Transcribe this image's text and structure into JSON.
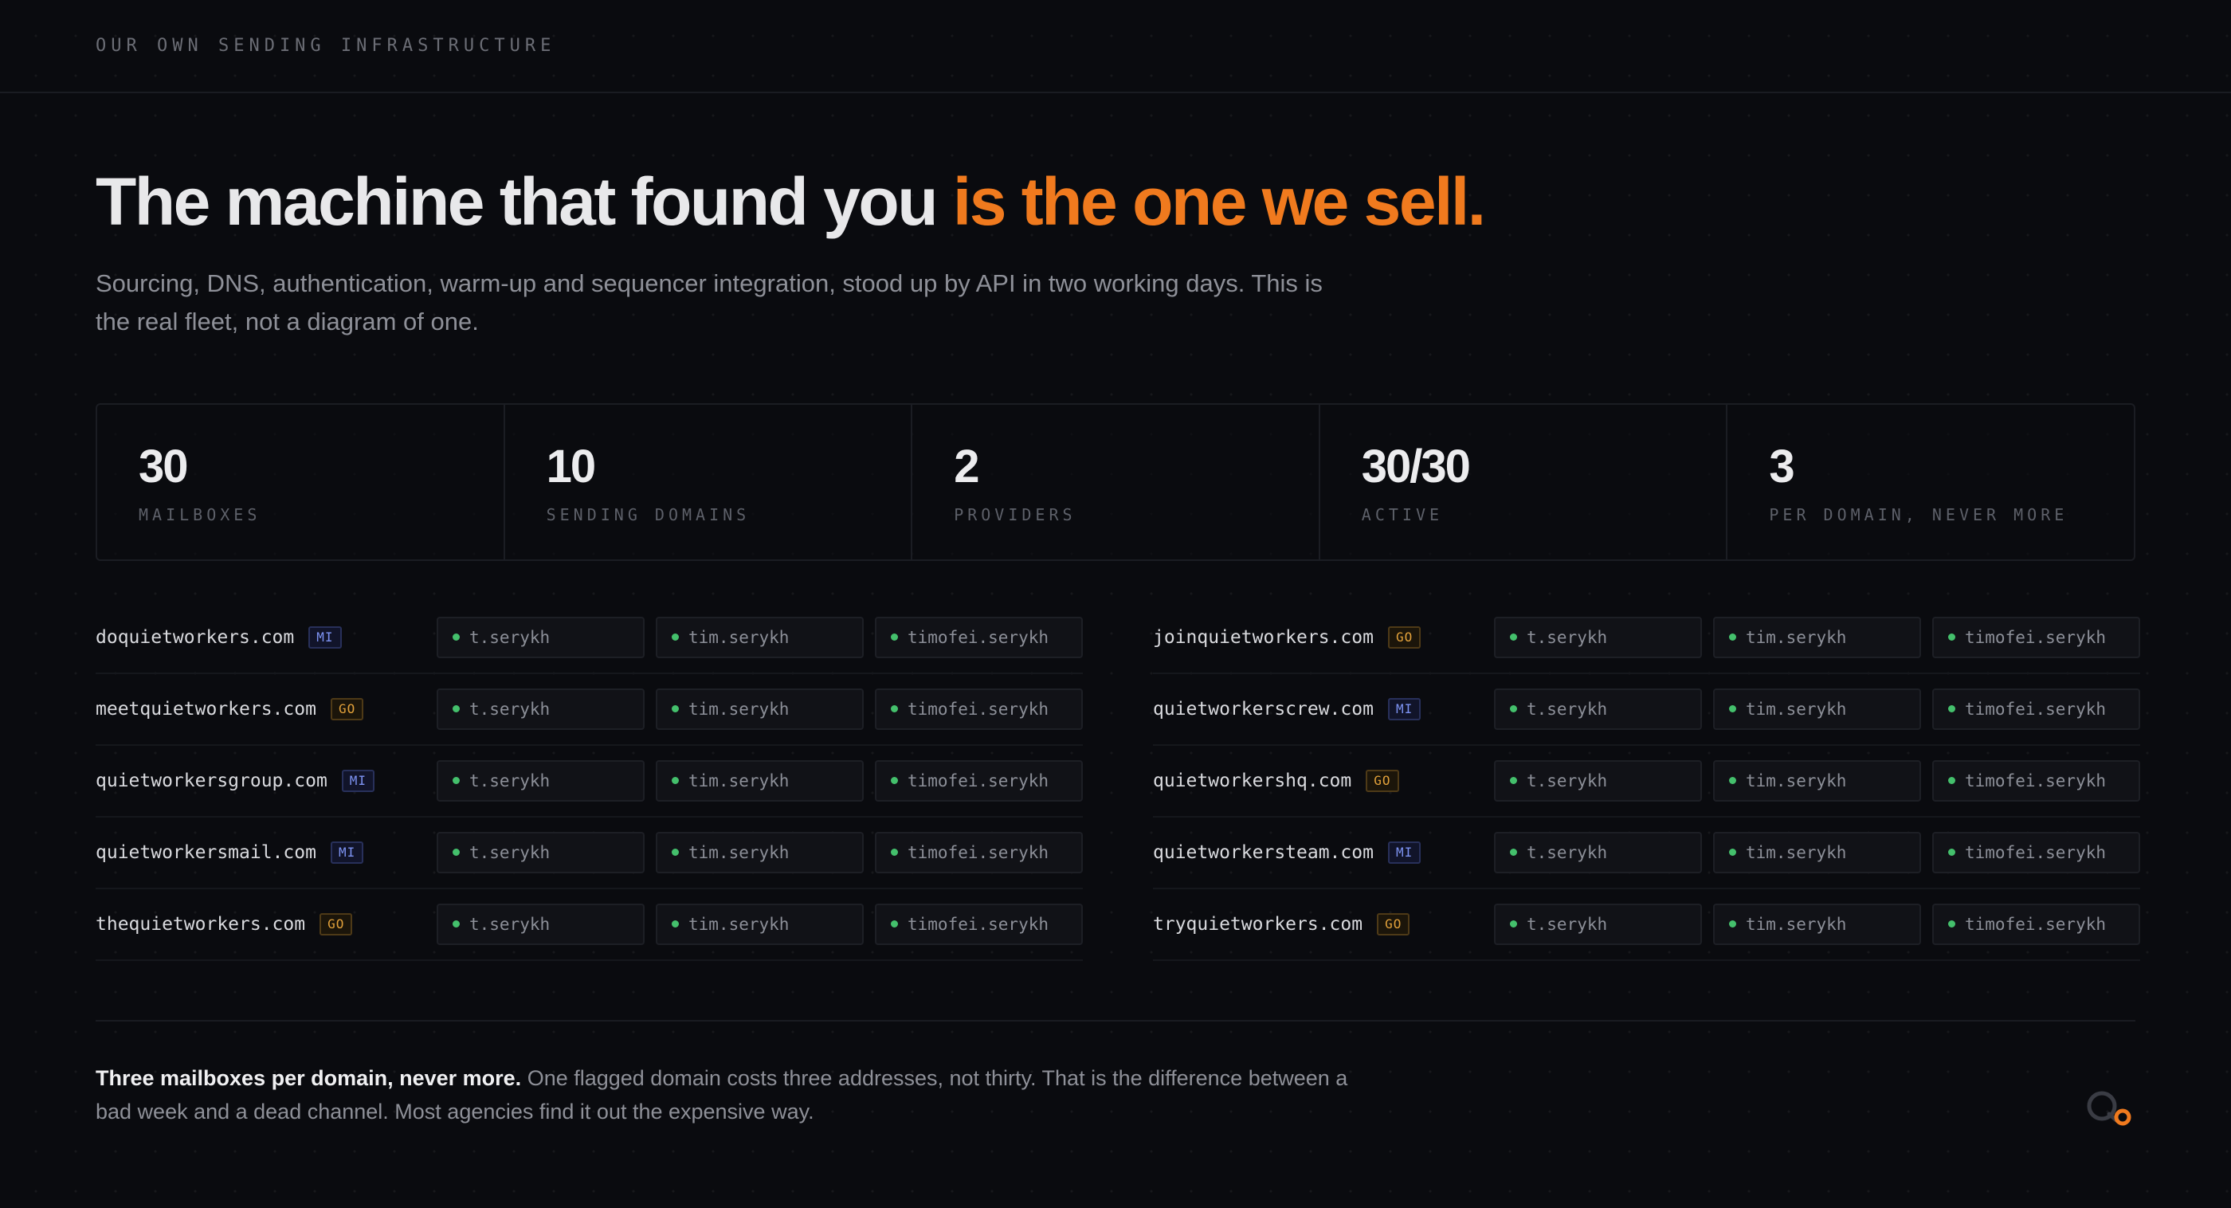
{
  "header": {
    "eyebrow": "OUR OWN SENDING INFRASTRUCTURE"
  },
  "hero": {
    "title_plain": "The machine that found you",
    "title_accent": "is the one we sell.",
    "subtitle": "Sourcing, DNS, authentication, warm-up and sequencer integration, stood up by API in two working days. This is the real fleet, not a diagram of one."
  },
  "stats": [
    {
      "value": "30",
      "label": "MAILBOXES"
    },
    {
      "value": "10",
      "label": "SENDING DOMAINS"
    },
    {
      "value": "2",
      "label": "PROVIDERS"
    },
    {
      "value": "30/30",
      "label": "ACTIVE"
    },
    {
      "value": "3",
      "label": "PER DOMAIN, NEVER MORE"
    }
  ],
  "mailbox_names": [
    "t.serykh",
    "tim.serykh",
    "timofei.serykh"
  ],
  "domains_left": [
    {
      "domain": "doquietworkers.com",
      "provider": "MI"
    },
    {
      "domain": "meetquietworkers.com",
      "provider": "GO"
    },
    {
      "domain": "quietworkersgroup.com",
      "provider": "MI"
    },
    {
      "domain": "quietworkersmail.com",
      "provider": "MI"
    },
    {
      "domain": "thequietworkers.com",
      "provider": "GO"
    }
  ],
  "domains_right": [
    {
      "domain": "joinquietworkers.com",
      "provider": "GO"
    },
    {
      "domain": "quietworkerscrew.com",
      "provider": "MI"
    },
    {
      "domain": "quietworkershq.com",
      "provider": "GO"
    },
    {
      "domain": "quietworkersteam.com",
      "provider": "MI"
    },
    {
      "domain": "tryquietworkers.com",
      "provider": "GO"
    }
  ],
  "footnote": {
    "bold": "Three mailboxes per domain, never more.",
    "text": " One flagged domain costs three addresses, not thirty. That is the difference between a bad week and a dead channel. Most agencies find it out the expensive way."
  },
  "colors": {
    "accent": "#f07a1e",
    "status_active": "#44c06c",
    "provider_mi": "#7d93f2",
    "provider_go": "#e2a13a"
  },
  "icons": {
    "logo": "q-logo-icon",
    "status": "status-dot-icon"
  }
}
